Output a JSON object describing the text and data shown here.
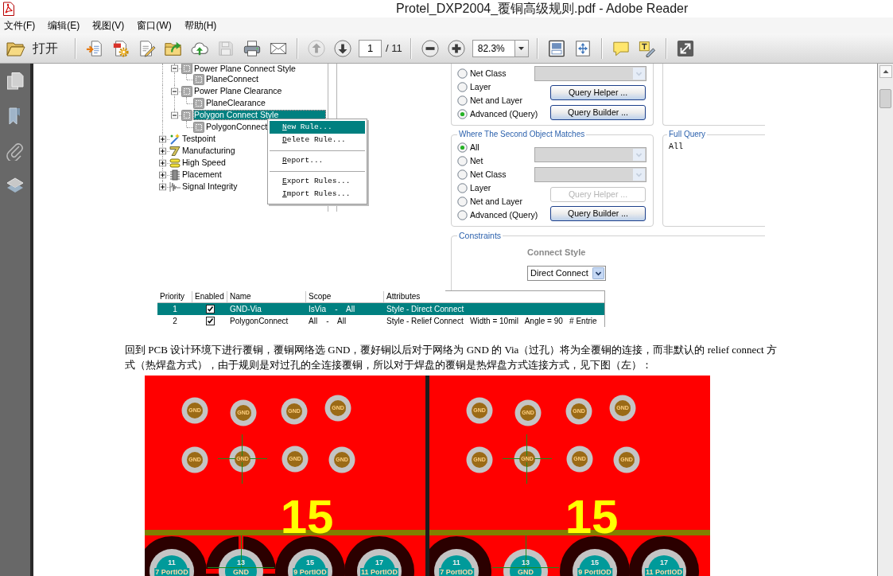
{
  "window": {
    "title": "Protel_DXP2004_覆铜高级规则.pdf - Adobe Reader"
  },
  "menu_bar": [
    "文件(F)",
    "编辑(E)",
    "视图(V)",
    "窗口(W)",
    "帮助(H)"
  ],
  "toolbar": {
    "groups": [
      {
        "items": [
          {
            "kind": "open",
            "label": "打开",
            "disabled": false
          }
        ]
      },
      {
        "items": [
          {
            "kind": "create",
            "disabled": false
          },
          {
            "kind": "settings",
            "disabled": false
          },
          {
            "kind": "edit",
            "disabled": false
          },
          {
            "kind": "folder",
            "disabled": false
          },
          {
            "kind": "upload",
            "disabled": false
          },
          {
            "kind": "save",
            "disabled": true
          },
          {
            "kind": "print",
            "disabled": false
          },
          {
            "kind": "email",
            "disabled": false
          }
        ]
      },
      {
        "items": [
          {
            "kind": "previous",
            "disabled": true
          },
          {
            "kind": "next",
            "disabled": false
          },
          {
            "kind": "page",
            "value": "1",
            "total": "/ 11"
          }
        ]
      },
      {
        "items": [
          {
            "kind": "zoomout",
            "disabled": false
          },
          {
            "kind": "zoomin",
            "disabled": false
          },
          {
            "kind": "zoom",
            "value": "82.3%"
          }
        ]
      },
      {
        "items": [
          {
            "kind": "fitpage",
            "disabled": false
          },
          {
            "kind": "fitwidth",
            "disabled": false
          }
        ]
      },
      {
        "items": [
          {
            "kind": "comment",
            "disabled": false
          },
          {
            "kind": "sign",
            "disabled": false
          }
        ]
      },
      {
        "items": [
          {
            "kind": "fullscreen",
            "disabled": false
          }
        ]
      }
    ]
  },
  "document": {
    "rule_tree": [
      {
        "children": [
          {
            "label": "Power Plane Connect Style",
            "kind": "ruletype",
            "expanded": true,
            "selected": false,
            "children": [
              {
                "label": "PlaneConnect",
                "kind": "rule",
                "selected": false
              }
            ]
          },
          {
            "label": "Power Plane Clearance",
            "kind": "ruletype",
            "expanded": true,
            "selected": false,
            "children": [
              {
                "label": "PlaneClearance",
                "kind": "rule",
                "selected": false
              }
            ]
          },
          {
            "label": "Polygon Connect Style",
            "kind": "ruletype",
            "expanded": true,
            "selected": true,
            "children": [
              {
                "label": "PolygonConnect",
                "kind": "rule",
                "selected": false
              }
            ]
          }
        ]
      },
      {
        "label": "Testpoint",
        "kind": "testpoint",
        "expanded": false,
        "selected": false
      },
      {
        "label": "Manufacturing",
        "kind": "manufacturing",
        "expanded": false,
        "selected": false
      },
      {
        "label": "High Speed",
        "kind": "highspeed",
        "expanded": false,
        "selected": false
      },
      {
        "label": "Placement",
        "kind": "placement",
        "expanded": false,
        "selected": false
      },
      {
        "label": "Signal Integrity",
        "kind": "signal",
        "expanded": false,
        "selected": false
      }
    ],
    "context_menu": [
      {
        "kind": "item",
        "label": "New Rule...",
        "selected": true
      },
      {
        "kind": "item",
        "label": "Delete Rule...",
        "selected": false
      },
      {
        "kind": "separator"
      },
      {
        "kind": "item",
        "label": "Report...",
        "selected": false
      },
      {
        "kind": "separator"
      },
      {
        "kind": "item",
        "label": "Export Rules...",
        "selected": false
      },
      {
        "kind": "item",
        "label": "Import Rules...",
        "selected": false
      }
    ],
    "first_object": {
      "options": [
        {
          "label": "Net Class",
          "selected": false
        },
        {
          "label": "Layer",
          "selected": false
        },
        {
          "label": "Net and Layer",
          "selected": false
        },
        {
          "label": "Advanced (Query)",
          "selected": true
        }
      ],
      "dropdowns": [
        {
          "disabled": true
        }
      ],
      "buttons": [
        {
          "label": "Query Helper ...",
          "disabled": false
        },
        {
          "label": "Query Builder ...",
          "disabled": false
        }
      ]
    },
    "second_object": {
      "title": "Where The Second Object Matches",
      "options": [
        {
          "label": "All",
          "selected": true
        },
        {
          "label": "Net",
          "selected": false
        },
        {
          "label": "Net Class",
          "selected": false
        },
        {
          "label": "Layer",
          "selected": false
        },
        {
          "label": "Net and Layer",
          "selected": false
        },
        {
          "label": "Advanced (Query)",
          "selected": false
        }
      ],
      "dropdowns": [
        {
          "disabled": true
        },
        {
          "disabled": true
        }
      ],
      "buttons": [
        {
          "label": "Query Helper ...",
          "disabled": true
        },
        {
          "label": "Query Builder ...",
          "disabled": false
        }
      ]
    },
    "full_query": {
      "title": "Full Query",
      "text": "All"
    },
    "constraints": {
      "title": "Constraints",
      "label": "Connect Style",
      "value": "Direct Connect"
    },
    "rules_table": {
      "columns": [
        "Priority",
        "Enabled",
        "Name",
        "Scope",
        "Attributes"
      ],
      "rows": [
        {
          "selected": true,
          "priority": "1",
          "enabled": true,
          "name": "GND-Via",
          "scope": "IsVia    -    All",
          "attributes": "Style - Direct Connect"
        },
        {
          "selected": false,
          "priority": "2",
          "enabled": true,
          "name": "PolygonConnect",
          "scope": "All    -    All",
          "attributes": "Style - Relief Connect   Width = 10mil   Angle = 90   # Entrie"
        }
      ]
    },
    "paragraph": "回到 PCB 设计环境下进行覆铜，覆铜网络选 GND，覆好铜以后对于网络为 GND 的 Via（过孔）将为全覆铜的连接，而非默认的 relief connect 方式（热焊盘方式），由于规则是对过孔的全连接覆铜，所以对于焊盘的覆铜是热焊盘方式连接方式，见下图（左）：",
    "pcb_views": [
      {
        "vias": [
          {
            "label": "GND",
            "crosshair": false
          },
          {
            "label": "GND",
            "crosshair": false
          },
          {
            "label": "GND",
            "crosshair": false
          },
          {
            "label": "GND",
            "crosshair": false
          },
          {
            "label": "GND",
            "crosshair": false
          },
          {
            "label": "GND",
            "crosshair": true
          },
          {
            "label": "GND",
            "crosshair": false
          },
          {
            "label": "GND",
            "crosshair": false
          }
        ],
        "designator": "15",
        "pads": [
          {
            "number": "11",
            "net": "7 PortIOD",
            "kind": "isolated",
            "crosshair": false
          },
          {
            "number": "13",
            "net": "GND",
            "kind": "relief",
            "crosshair": true
          },
          {
            "number": "15",
            "net": "9 PortIOD",
            "kind": "isolated",
            "crosshair": false
          },
          {
            "number": "17",
            "net": "11 PortIOD",
            "kind": "isolated",
            "crosshair": false
          }
        ]
      },
      {
        "vias": [
          {
            "label": "GND",
            "crosshair": false
          },
          {
            "label": "GND",
            "crosshair": false
          },
          {
            "label": "GND",
            "crosshair": false
          },
          {
            "label": "GND",
            "crosshair": false
          },
          {
            "label": "GND",
            "crosshair": false
          },
          {
            "label": "GND",
            "crosshair": true
          },
          {
            "label": "GND",
            "crosshair": false
          },
          {
            "label": "GND",
            "crosshair": false
          }
        ],
        "designator": "15",
        "pads": [
          {
            "number": "11",
            "net": "7 PortIOD",
            "kind": "isolated",
            "crosshair": false
          },
          {
            "number": "13",
            "net": "GND",
            "kind": "direct",
            "crosshair": true
          },
          {
            "number": "15",
            "net": "9 PortIOD",
            "kind": "isolated",
            "crosshair": false
          },
          {
            "number": "17",
            "net": "11 PortIOD",
            "kind": "isolated",
            "crosshair": false
          }
        ]
      }
    ]
  }
}
